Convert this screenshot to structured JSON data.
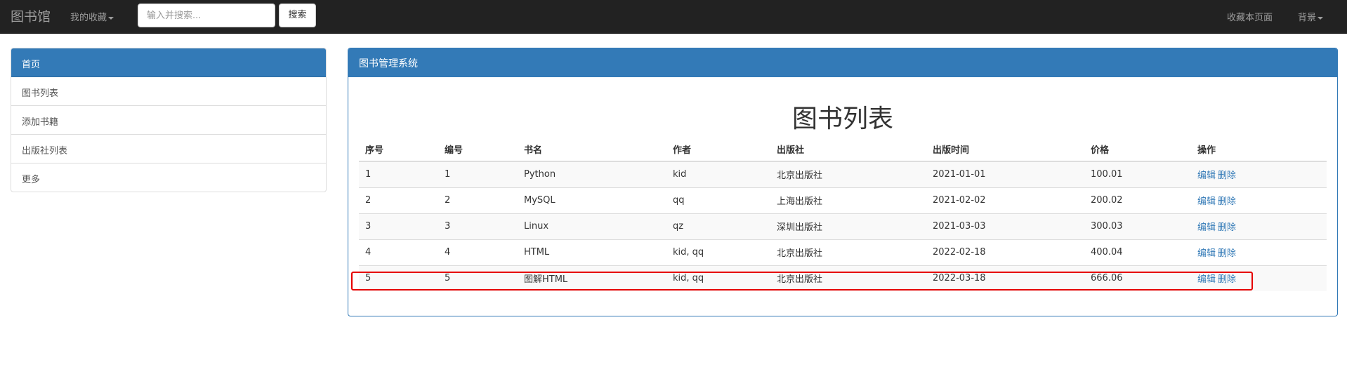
{
  "navbar": {
    "brand": "图书馆",
    "favorites_label": "我的收藏",
    "search_placeholder": "输入并搜索...",
    "search_button": "搜索",
    "bookmark_label": "收藏本页面",
    "background_label": "背景"
  },
  "sidebar": {
    "header": "首页",
    "items": [
      {
        "label": "图书列表"
      },
      {
        "label": "添加书籍"
      },
      {
        "label": "出版社列表"
      },
      {
        "label": "更多"
      }
    ]
  },
  "panel": {
    "header": "图书管理系统",
    "title": "图书列表"
  },
  "table": {
    "columns": [
      "序号",
      "编号",
      "书名",
      "作者",
      "出版社",
      "出版时间",
      "价格",
      "操作"
    ],
    "action_edit": "编辑",
    "action_delete": "删除",
    "rows": [
      {
        "seq": "1",
        "id": "1",
        "title": "Python",
        "author": "kid",
        "publisher": "北京出版社",
        "date": "2021-01-01",
        "price": "100.01"
      },
      {
        "seq": "2",
        "id": "2",
        "title": "MySQL",
        "author": "qq",
        "publisher": "上海出版社",
        "date": "2021-02-02",
        "price": "200.02"
      },
      {
        "seq": "3",
        "id": "3",
        "title": "Linux",
        "author": "qz",
        "publisher": "深圳出版社",
        "date": "2021-03-03",
        "price": "300.03"
      },
      {
        "seq": "4",
        "id": "4",
        "title": "HTML",
        "author": "kid, qq",
        "publisher": "北京出版社",
        "date": "2022-02-18",
        "price": "400.04"
      },
      {
        "seq": "5",
        "id": "5",
        "title": "图解HTML",
        "author": "kid, qq",
        "publisher": "北京出版社",
        "date": "2022-03-18",
        "price": "666.06"
      }
    ]
  },
  "colors": {
    "navbar_bg": "#222222",
    "primary": "#337ab7",
    "highlight_border": "#e60000"
  }
}
